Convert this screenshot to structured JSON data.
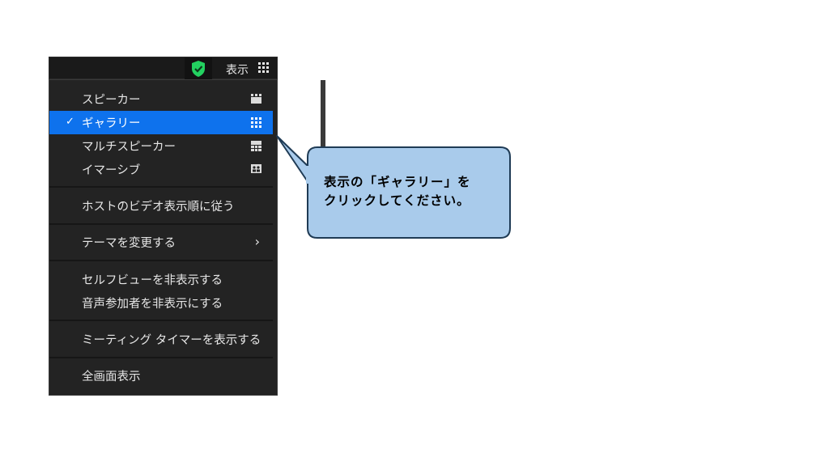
{
  "topbar": {
    "view_label": "表示"
  },
  "menu": {
    "layouts": [
      {
        "label": "スピーカー",
        "icon": "speaker-layout-icon",
        "selected": false
      },
      {
        "label": "ギャラリー",
        "icon": "gallery-grid-icon",
        "selected": true
      },
      {
        "label": "マルチスピーカー",
        "icon": "multi-speaker-icon",
        "selected": false
      },
      {
        "label": "イマーシブ",
        "icon": "immersive-icon",
        "selected": false
      }
    ],
    "follow_host_order": "ホストのビデオ表示順に従う",
    "change_theme": "テーマを変更する",
    "hide_self_view": "セルフビューを非表示する",
    "hide_audio_participants": "音声参加者を非表示にする",
    "show_meeting_timer": "ミーティング タイマーを表示する",
    "fullscreen": "全画面表示"
  },
  "callout": {
    "line1": "表示の「ギャラリー」を",
    "line2": "クリックしてください。"
  },
  "colors": {
    "selected_bg": "#0e72ed",
    "menu_bg": "#232323",
    "shield_green": "#23d160",
    "callout_fill": "#a9cbeb",
    "callout_border": "#1f3b55"
  }
}
